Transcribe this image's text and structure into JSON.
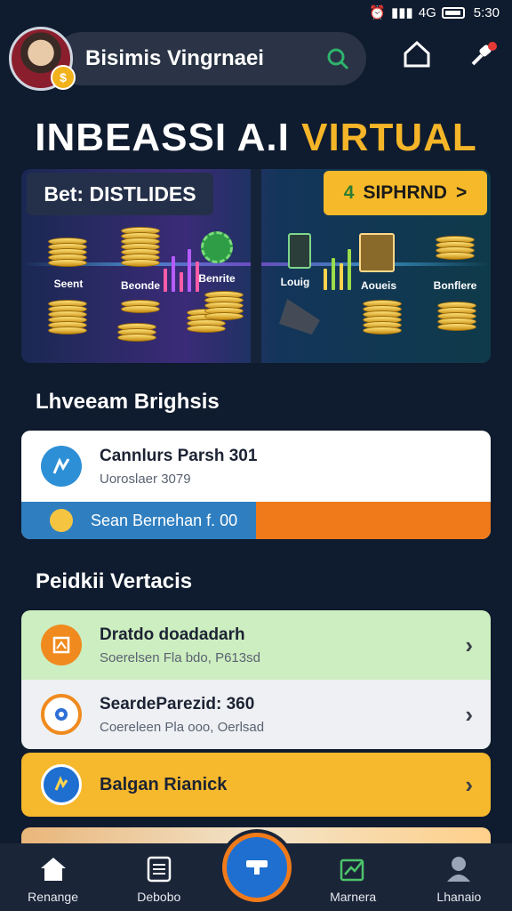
{
  "status_bar": {
    "time": "5:30",
    "signal": "4G"
  },
  "header": {
    "title": "Bisimis Vingrnaei"
  },
  "hero": {
    "title_white": "INBEASSI A.I",
    "title_gold": "VIRTUAL"
  },
  "banner": {
    "bet_label": "Bet: DISTLIDES",
    "cta_label": "SIPHRND",
    "cta_prefix": "4",
    "cta_suffix": ">",
    "labels": [
      "Seent",
      "Beonde",
      "Benrite",
      "Louig",
      "Aoueis",
      "Bonflere"
    ]
  },
  "section1": {
    "title": "Lhveeam Brighsis"
  },
  "summary_card": {
    "title": "Cannlurs Parsh 301",
    "subtitle": "Uoroslaer 3079",
    "bar_label": "Sean Bernehan f. 00"
  },
  "section2": {
    "title": "Peidkii Vertacis"
  },
  "list": [
    {
      "title": "Dratdo doadadarh",
      "subtitle": "Soerelsen Fla bdo, P613sd"
    },
    {
      "title": "SeardeParezid: 360",
      "subtitle": "Coereleen Pla ooo, Oerlsad"
    },
    {
      "title": "Balgan Rianick",
      "subtitle": ""
    }
  ],
  "bottom_nav": [
    {
      "label": "Renange"
    },
    {
      "label": "Debobo"
    },
    {
      "label": "Marnera"
    },
    {
      "label": "Lhanaio"
    }
  ],
  "colors": {
    "background": "#0f1b2e",
    "gold": "#f5b528",
    "blue": "#2f7fc0",
    "orange": "#f07a1a",
    "green_card": "#cdeec0",
    "yellow_card": "#f6b82c"
  }
}
